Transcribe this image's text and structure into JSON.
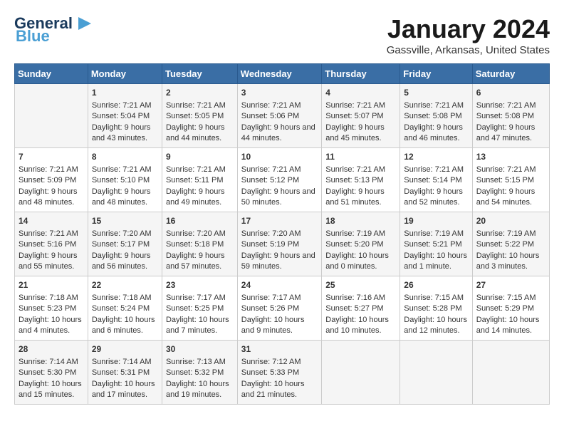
{
  "header": {
    "logo_line1": "General",
    "logo_line2": "Blue",
    "month": "January 2024",
    "location": "Gassville, Arkansas, United States"
  },
  "weekdays": [
    "Sunday",
    "Monday",
    "Tuesday",
    "Wednesday",
    "Thursday",
    "Friday",
    "Saturday"
  ],
  "weeks": [
    [
      {
        "day": "",
        "sunrise": "",
        "sunset": "",
        "daylight": ""
      },
      {
        "day": "1",
        "sunrise": "Sunrise: 7:21 AM",
        "sunset": "Sunset: 5:04 PM",
        "daylight": "Daylight: 9 hours and 43 minutes."
      },
      {
        "day": "2",
        "sunrise": "Sunrise: 7:21 AM",
        "sunset": "Sunset: 5:05 PM",
        "daylight": "Daylight: 9 hours and 44 minutes."
      },
      {
        "day": "3",
        "sunrise": "Sunrise: 7:21 AM",
        "sunset": "Sunset: 5:06 PM",
        "daylight": "Daylight: 9 hours and 44 minutes."
      },
      {
        "day": "4",
        "sunrise": "Sunrise: 7:21 AM",
        "sunset": "Sunset: 5:07 PM",
        "daylight": "Daylight: 9 hours and 45 minutes."
      },
      {
        "day": "5",
        "sunrise": "Sunrise: 7:21 AM",
        "sunset": "Sunset: 5:08 PM",
        "daylight": "Daylight: 9 hours and 46 minutes."
      },
      {
        "day": "6",
        "sunrise": "Sunrise: 7:21 AM",
        "sunset": "Sunset: 5:08 PM",
        "daylight": "Daylight: 9 hours and 47 minutes."
      }
    ],
    [
      {
        "day": "7",
        "sunrise": "Sunrise: 7:21 AM",
        "sunset": "Sunset: 5:09 PM",
        "daylight": "Daylight: 9 hours and 48 minutes."
      },
      {
        "day": "8",
        "sunrise": "Sunrise: 7:21 AM",
        "sunset": "Sunset: 5:10 PM",
        "daylight": "Daylight: 9 hours and 48 minutes."
      },
      {
        "day": "9",
        "sunrise": "Sunrise: 7:21 AM",
        "sunset": "Sunset: 5:11 PM",
        "daylight": "Daylight: 9 hours and 49 minutes."
      },
      {
        "day": "10",
        "sunrise": "Sunrise: 7:21 AM",
        "sunset": "Sunset: 5:12 PM",
        "daylight": "Daylight: 9 hours and 50 minutes."
      },
      {
        "day": "11",
        "sunrise": "Sunrise: 7:21 AM",
        "sunset": "Sunset: 5:13 PM",
        "daylight": "Daylight: 9 hours and 51 minutes."
      },
      {
        "day": "12",
        "sunrise": "Sunrise: 7:21 AM",
        "sunset": "Sunset: 5:14 PM",
        "daylight": "Daylight: 9 hours and 52 minutes."
      },
      {
        "day": "13",
        "sunrise": "Sunrise: 7:21 AM",
        "sunset": "Sunset: 5:15 PM",
        "daylight": "Daylight: 9 hours and 54 minutes."
      }
    ],
    [
      {
        "day": "14",
        "sunrise": "Sunrise: 7:21 AM",
        "sunset": "Sunset: 5:16 PM",
        "daylight": "Daylight: 9 hours and 55 minutes."
      },
      {
        "day": "15",
        "sunrise": "Sunrise: 7:20 AM",
        "sunset": "Sunset: 5:17 PM",
        "daylight": "Daylight: 9 hours and 56 minutes."
      },
      {
        "day": "16",
        "sunrise": "Sunrise: 7:20 AM",
        "sunset": "Sunset: 5:18 PM",
        "daylight": "Daylight: 9 hours and 57 minutes."
      },
      {
        "day": "17",
        "sunrise": "Sunrise: 7:20 AM",
        "sunset": "Sunset: 5:19 PM",
        "daylight": "Daylight: 9 hours and 59 minutes."
      },
      {
        "day": "18",
        "sunrise": "Sunrise: 7:19 AM",
        "sunset": "Sunset: 5:20 PM",
        "daylight": "Daylight: 10 hours and 0 minutes."
      },
      {
        "day": "19",
        "sunrise": "Sunrise: 7:19 AM",
        "sunset": "Sunset: 5:21 PM",
        "daylight": "Daylight: 10 hours and 1 minute."
      },
      {
        "day": "20",
        "sunrise": "Sunrise: 7:19 AM",
        "sunset": "Sunset: 5:22 PM",
        "daylight": "Daylight: 10 hours and 3 minutes."
      }
    ],
    [
      {
        "day": "21",
        "sunrise": "Sunrise: 7:18 AM",
        "sunset": "Sunset: 5:23 PM",
        "daylight": "Daylight: 10 hours and 4 minutes."
      },
      {
        "day": "22",
        "sunrise": "Sunrise: 7:18 AM",
        "sunset": "Sunset: 5:24 PM",
        "daylight": "Daylight: 10 hours and 6 minutes."
      },
      {
        "day": "23",
        "sunrise": "Sunrise: 7:17 AM",
        "sunset": "Sunset: 5:25 PM",
        "daylight": "Daylight: 10 hours and 7 minutes."
      },
      {
        "day": "24",
        "sunrise": "Sunrise: 7:17 AM",
        "sunset": "Sunset: 5:26 PM",
        "daylight": "Daylight: 10 hours and 9 minutes."
      },
      {
        "day": "25",
        "sunrise": "Sunrise: 7:16 AM",
        "sunset": "Sunset: 5:27 PM",
        "daylight": "Daylight: 10 hours and 10 minutes."
      },
      {
        "day": "26",
        "sunrise": "Sunrise: 7:15 AM",
        "sunset": "Sunset: 5:28 PM",
        "daylight": "Daylight: 10 hours and 12 minutes."
      },
      {
        "day": "27",
        "sunrise": "Sunrise: 7:15 AM",
        "sunset": "Sunset: 5:29 PM",
        "daylight": "Daylight: 10 hours and 14 minutes."
      }
    ],
    [
      {
        "day": "28",
        "sunrise": "Sunrise: 7:14 AM",
        "sunset": "Sunset: 5:30 PM",
        "daylight": "Daylight: 10 hours and 15 minutes."
      },
      {
        "day": "29",
        "sunrise": "Sunrise: 7:14 AM",
        "sunset": "Sunset: 5:31 PM",
        "daylight": "Daylight: 10 hours and 17 minutes."
      },
      {
        "day": "30",
        "sunrise": "Sunrise: 7:13 AM",
        "sunset": "Sunset: 5:32 PM",
        "daylight": "Daylight: 10 hours and 19 minutes."
      },
      {
        "day": "31",
        "sunrise": "Sunrise: 7:12 AM",
        "sunset": "Sunset: 5:33 PM",
        "daylight": "Daylight: 10 hours and 21 minutes."
      },
      {
        "day": "",
        "sunrise": "",
        "sunset": "",
        "daylight": ""
      },
      {
        "day": "",
        "sunrise": "",
        "sunset": "",
        "daylight": ""
      },
      {
        "day": "",
        "sunrise": "",
        "sunset": "",
        "daylight": ""
      }
    ]
  ]
}
